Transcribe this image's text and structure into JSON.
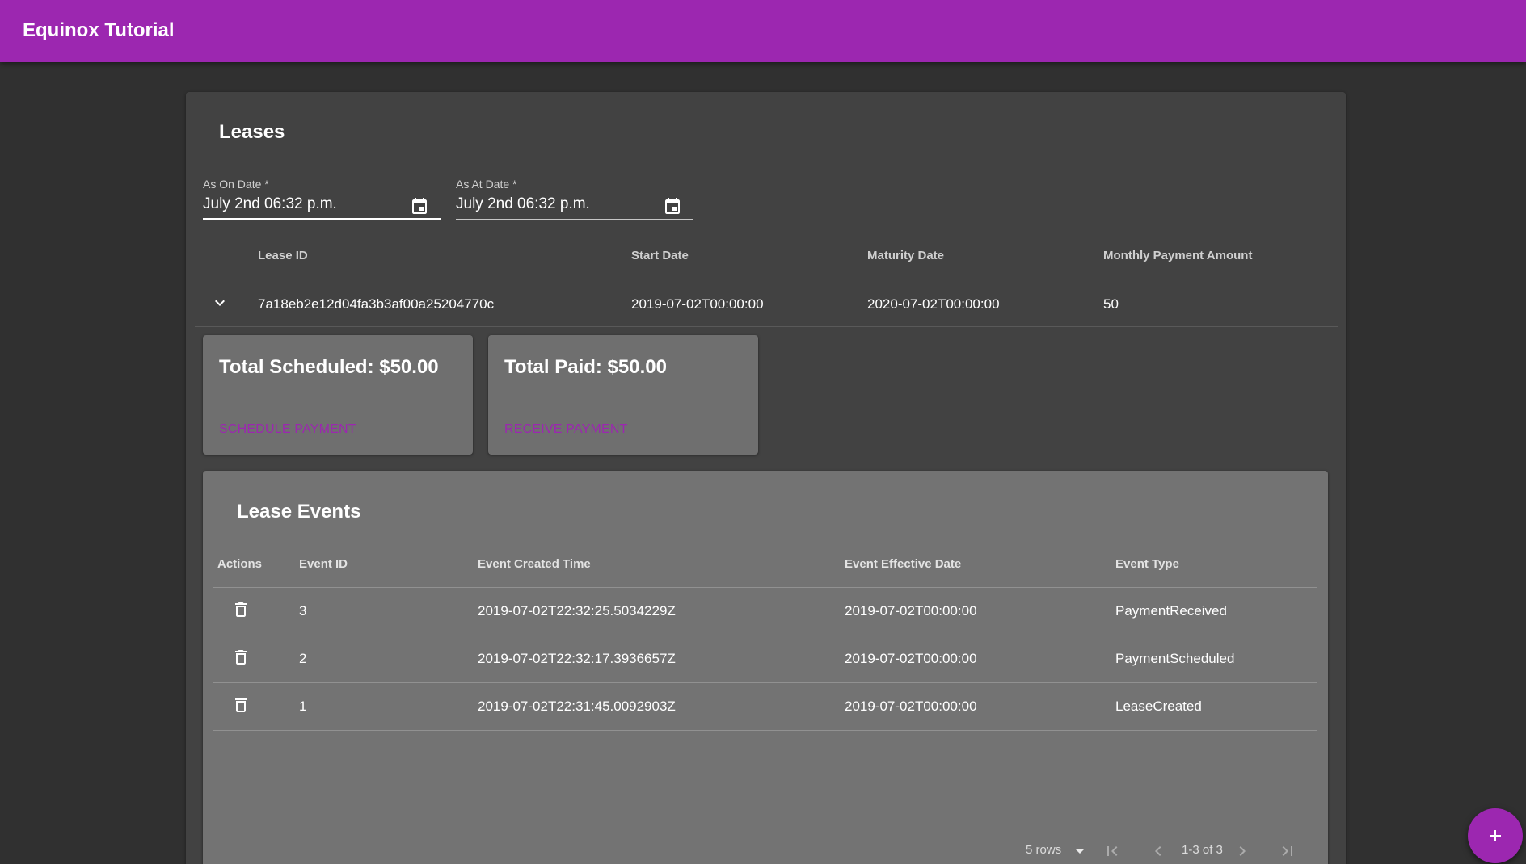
{
  "app": {
    "title": "Equinox Tutorial"
  },
  "leases": {
    "title": "Leases",
    "as_on_date": {
      "label": "As On Date *",
      "value": "July 2nd 06:32 p.m."
    },
    "as_at_date": {
      "label": "As At Date *",
      "value": "July 2nd 06:32 p.m."
    },
    "columns": [
      "Lease ID",
      "Start Date",
      "Maturity Date",
      "Monthly Payment Amount"
    ],
    "rows": [
      {
        "lease_id": "7a18eb2e12d04fa3b3af00a25204770c",
        "start_date": "2019-07-02T00:00:00",
        "maturity_date": "2020-07-02T00:00:00",
        "monthly_payment": "50"
      }
    ]
  },
  "cards": {
    "scheduled": {
      "title": "Total Scheduled: $50.00",
      "action": "Schedule Payment"
    },
    "paid": {
      "title": "Total Paid: $50.00",
      "action": "Receive Payment"
    }
  },
  "events": {
    "title": "Lease Events",
    "columns": [
      "Actions",
      "Event ID",
      "Event Created Time",
      "Event Effective Date",
      "Event Type"
    ],
    "rows": [
      {
        "id": "3",
        "created": "2019-07-02T22:32:25.5034229Z",
        "effective": "2019-07-02T00:00:00",
        "type": "PaymentReceived"
      },
      {
        "id": "2",
        "created": "2019-07-02T22:32:17.3936657Z",
        "effective": "2019-07-02T00:00:00",
        "type": "PaymentScheduled"
      },
      {
        "id": "1",
        "created": "2019-07-02T22:31:45.0092903Z",
        "effective": "2019-07-02T00:00:00",
        "type": "LeaseCreated"
      }
    ],
    "pagination": {
      "rows_per_page": "5 rows",
      "range": "1-3 of 3"
    }
  },
  "icons": {
    "calendar": "calendar-icon",
    "expand": "chevron-down-icon",
    "delete": "trash-icon",
    "first_page": "first-page-icon",
    "prev_page": "chevron-left-icon",
    "next_page": "chevron-right-icon",
    "last_page": "last-page-icon",
    "add": "plus-icon"
  },
  "colors": {
    "primary": "#9c27b0",
    "background": "#303030",
    "paper": "#424242",
    "card": "#6f6f6f"
  }
}
